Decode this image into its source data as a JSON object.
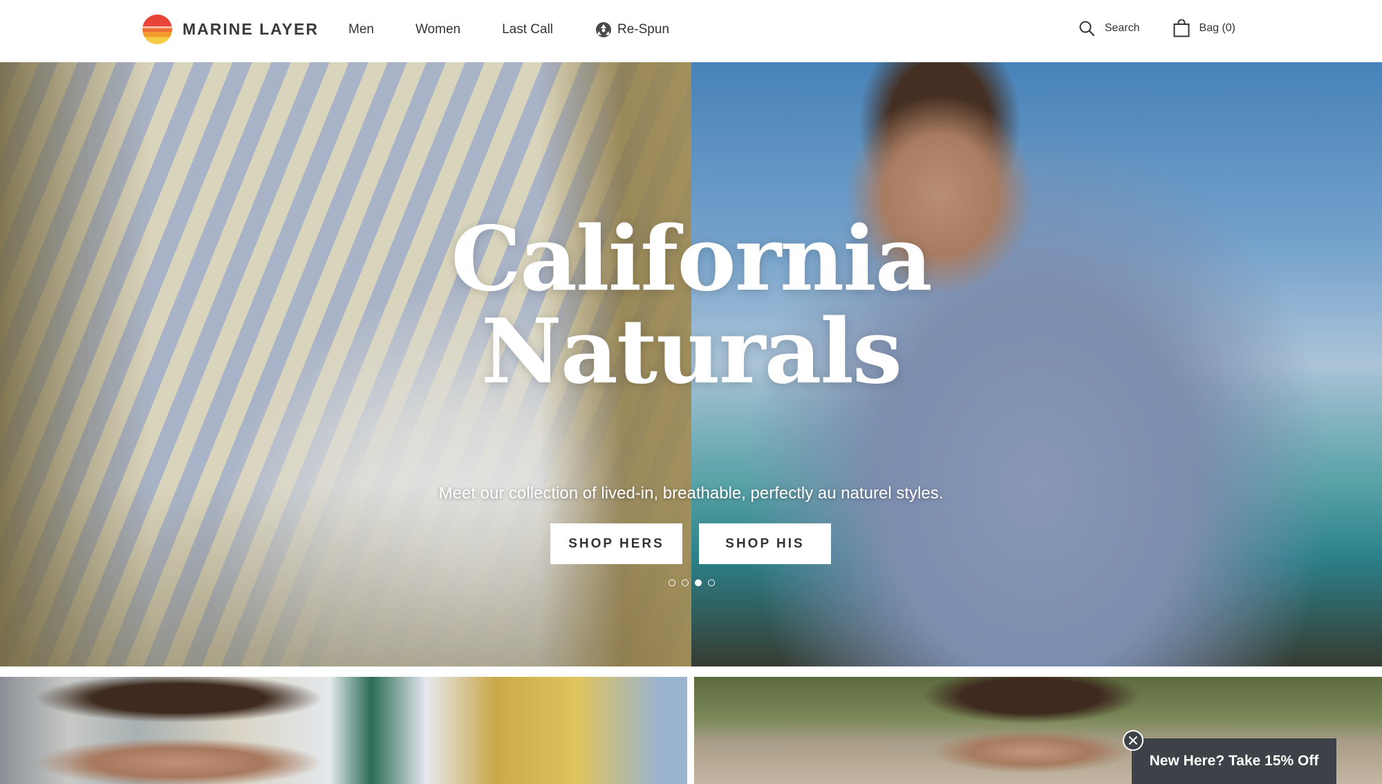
{
  "brand": {
    "name": "MARINE LAYER"
  },
  "nav": {
    "items": [
      {
        "label": "Men"
      },
      {
        "label": "Women"
      },
      {
        "label": "Last Call"
      },
      {
        "label": "Re-Spun",
        "icon": "recycle-icon"
      }
    ]
  },
  "utility": {
    "search_label": "Search",
    "bag_label": "Bag (0)"
  },
  "hero": {
    "title_line1": "California",
    "title_line2": "Naturals",
    "subtitle": "Meet our collection of lived-in, breathable, perfectly au naturel styles.",
    "shop_hers_label": "SHOP HERS",
    "shop_his_label": "SHOP HIS",
    "carousel": {
      "slide_count": 4,
      "active_index": 2
    }
  },
  "promo": {
    "label": "New Here? Take 15% Off",
    "close_icon": "close-icon"
  },
  "colors": {
    "promo_bg": "#3c4248",
    "text_dark": "#333333",
    "logo_red": "#e8443a",
    "logo_orange": "#f29a2e",
    "logo_yellow": "#f6c944"
  }
}
